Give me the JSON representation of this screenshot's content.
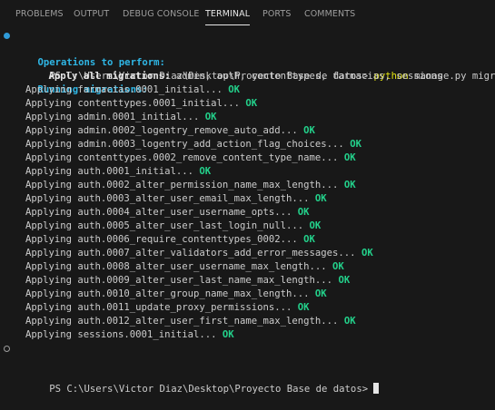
{
  "tabs": [
    {
      "label": "PROBLEMS",
      "active": false
    },
    {
      "label": "OUTPUT",
      "active": false
    },
    {
      "label": "DEBUG CONSOLE",
      "active": false
    },
    {
      "label": "TERMINAL",
      "active": true
    },
    {
      "label": "PORTS",
      "active": false
    },
    {
      "label": "COMMENTS",
      "active": false
    }
  ],
  "terminal": {
    "prompt": "PS C:\\Users\\Victor Diaz\\Desktop\\Proyecto Base de datos>",
    "command_exe": "python",
    "command_args": "manage.py migrate",
    "operations_header": "Operations to perform:",
    "apply_label": "Apply all migrations:",
    "apply_apps": "admin, auth, contenttypes, farmacias, sessions",
    "running_header": "Running migrations:",
    "ok_text": "OK",
    "migrations": [
      "Applying farmacias.0001_initial...",
      "Applying contenttypes.0001_initial...",
      "Applying admin.0001_initial...",
      "Applying admin.0002_logentry_remove_auto_add...",
      "Applying admin.0003_logentry_add_action_flag_choices...",
      "Applying contenttypes.0002_remove_content_type_name...",
      "Applying auth.0001_initial...",
      "Applying auth.0002_alter_permission_name_max_length...",
      "Applying auth.0003_alter_user_email_max_length...",
      "Applying auth.0004_alter_user_username_opts...",
      "Applying auth.0005_alter_user_last_login_null...",
      "Applying auth.0006_require_contenttypes_0002...",
      "Applying auth.0007_alter_validators_add_error_messages...",
      "Applying auth.0008_alter_user_username_max_length...",
      "Applying auth.0009_alter_user_last_name_max_length...",
      "Applying auth.0010_alter_group_name_max_length...",
      "Applying auth.0011_update_proxy_permissions...",
      "Applying auth.0012_alter_user_first_name_max_length...",
      "Applying sessions.0001_initial..."
    ],
    "final_prompt": "PS C:\\Users\\Victor Diaz\\Desktop\\Proyecto Base de datos>"
  },
  "colors": {
    "background": "#181818",
    "prompt_dot": "#2f9bd8",
    "header_cyan": "#2fb6e5",
    "command_yellow": "#e5e510",
    "ok_green": "#23d18b"
  }
}
